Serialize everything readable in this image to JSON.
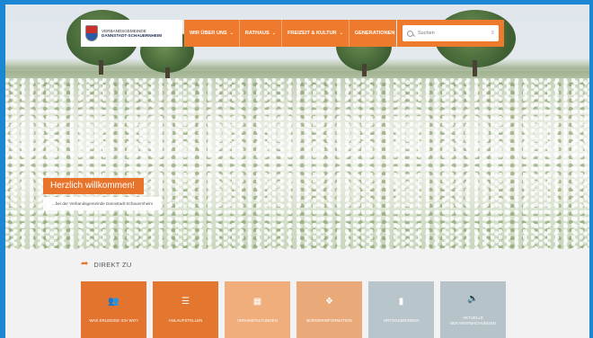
{
  "header": {
    "logo": {
      "line1": "Verbandsgemeinde",
      "line2": "Dannstadt-Schauernheim"
    },
    "nav": [
      {
        "label": "WIR ÜBER UNS"
      },
      {
        "label": "RATHAUS"
      },
      {
        "label": "FREIZEIT & KULTUR"
      },
      {
        "label": "GENERATIONEN"
      }
    ],
    "search": {
      "placeholder": "Suchen"
    }
  },
  "hero": {
    "title": "Herzlich willkommen!",
    "subtitle": "...bei der Verbandsgemeinde Dannstadt-Schauernheim"
  },
  "quicklinks": {
    "heading": "DIREKT ZU",
    "tiles": [
      {
        "label": "WAS ERLEDIGE ICH WO?",
        "icon": "users-icon"
      },
      {
        "label": "ANLAUFSTELLEN",
        "icon": "list-icon"
      },
      {
        "label": "VERANSTALTUNGEN",
        "icon": "calendar-icon"
      },
      {
        "label": "BÜRGERINFORMATION",
        "icon": "handshake-icon"
      },
      {
        "label": "ORTSGEMEINDEN",
        "icon": "bookmark-icon"
      },
      {
        "label": "AKTUELLE BEKANNTMACHUNGEN",
        "icon": "speaker-icon"
      }
    ]
  },
  "colors": {
    "accent": "#e8742c",
    "frame": "#1b86d2"
  }
}
